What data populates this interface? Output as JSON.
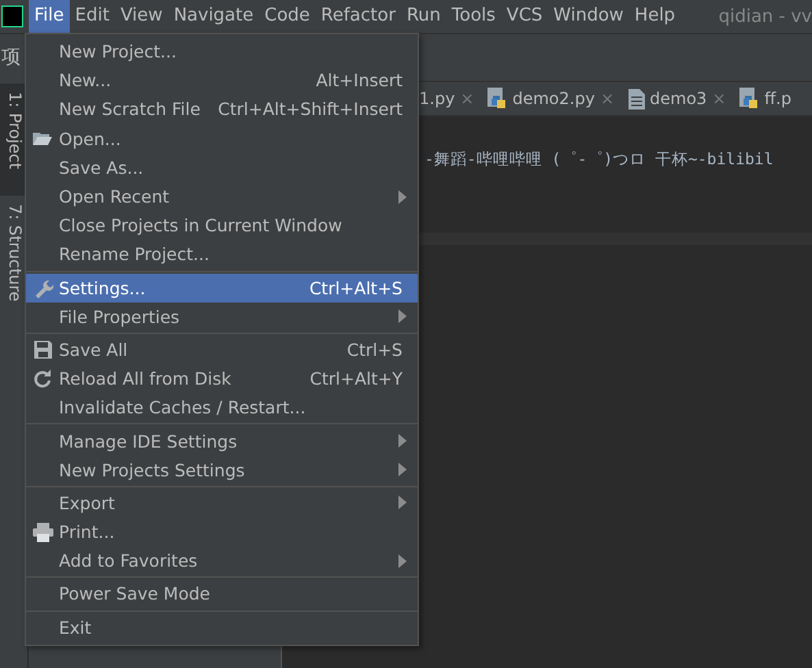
{
  "menubar": {
    "items": [
      {
        "label": "File",
        "selected": true
      },
      {
        "label": "Edit",
        "selected": false
      },
      {
        "label": "View",
        "selected": false
      },
      {
        "label": "Navigate",
        "selected": false
      },
      {
        "label": "Code",
        "selected": false
      },
      {
        "label": "Refactor",
        "selected": false
      },
      {
        "label": "Run",
        "selected": false
      },
      {
        "label": "Tools",
        "selected": false
      },
      {
        "label": "VCS",
        "selected": false
      },
      {
        "label": "Window",
        "selected": false
      },
      {
        "label": "Help",
        "selected": false
      }
    ],
    "title": "qidian - vv"
  },
  "sidebar": {
    "header": "项",
    "tabs": [
      "1: Project",
      "7: Structure"
    ]
  },
  "editor": {
    "tabs": [
      {
        "label": "1.py",
        "kind": "plain",
        "close": "×"
      },
      {
        "label": "demo2.py",
        "kind": "python",
        "close": "×"
      },
      {
        "label": "demo3",
        "kind": "text",
        "close": "×"
      },
      {
        "label": "ff.p",
        "kind": "python"
      }
    ],
    "line": "-舞蹈-哔哩哔哩 (゜-゜)つロ 干杯~-bilibil"
  },
  "file_menu": {
    "groups": [
      [
        {
          "label": "New Project...",
          "kind": "plain",
          "selected": false
        },
        {
          "label": "New...",
          "shortcut": "Alt+Insert",
          "kind": "plain",
          "selected": false
        },
        {
          "label": "New Scratch File",
          "shortcut": "Ctrl+Alt+Shift+Insert",
          "kind": "plain",
          "selected": false
        },
        {
          "label": "Open...",
          "kind": "folder",
          "selected": false
        },
        {
          "label": "Save As...",
          "kind": "plain",
          "selected": false
        },
        {
          "label": "Open Recent",
          "submenu": true,
          "kind": "plain",
          "selected": false
        },
        {
          "label": "Close Projects in Current Window",
          "kind": "plain",
          "selected": false
        },
        {
          "label": "Rename Project...",
          "kind": "plain",
          "selected": false
        }
      ],
      [
        {
          "label": "Settings...",
          "shortcut": "Ctrl+Alt+S",
          "kind": "wrench",
          "selected": true
        },
        {
          "label": "File Properties",
          "submenu": true,
          "kind": "plain",
          "selected": false
        }
      ],
      [
        {
          "label": "Save All",
          "shortcut": "Ctrl+S",
          "kind": "save",
          "selected": false
        },
        {
          "label": "Reload All from Disk",
          "shortcut": "Ctrl+Alt+Y",
          "kind": "reload",
          "selected": false
        },
        {
          "label": "Invalidate Caches / Restart...",
          "kind": "plain",
          "selected": false
        }
      ],
      [
        {
          "label": "Manage IDE Settings",
          "submenu": true,
          "kind": "plain",
          "selected": false
        },
        {
          "label": "New Projects Settings",
          "submenu": true,
          "kind": "plain",
          "selected": false
        }
      ],
      [
        {
          "label": "Export",
          "submenu": true,
          "kind": "plain",
          "selected": false
        },
        {
          "label": "Print...",
          "kind": "print",
          "selected": false
        },
        {
          "label": "Add to Favorites",
          "submenu": true,
          "kind": "plain",
          "selected": false
        }
      ],
      [
        {
          "label": "Power Save Mode",
          "kind": "plain",
          "selected": false
        }
      ],
      [
        {
          "label": "Exit",
          "kind": "plain",
          "selected": false
        }
      ]
    ]
  }
}
